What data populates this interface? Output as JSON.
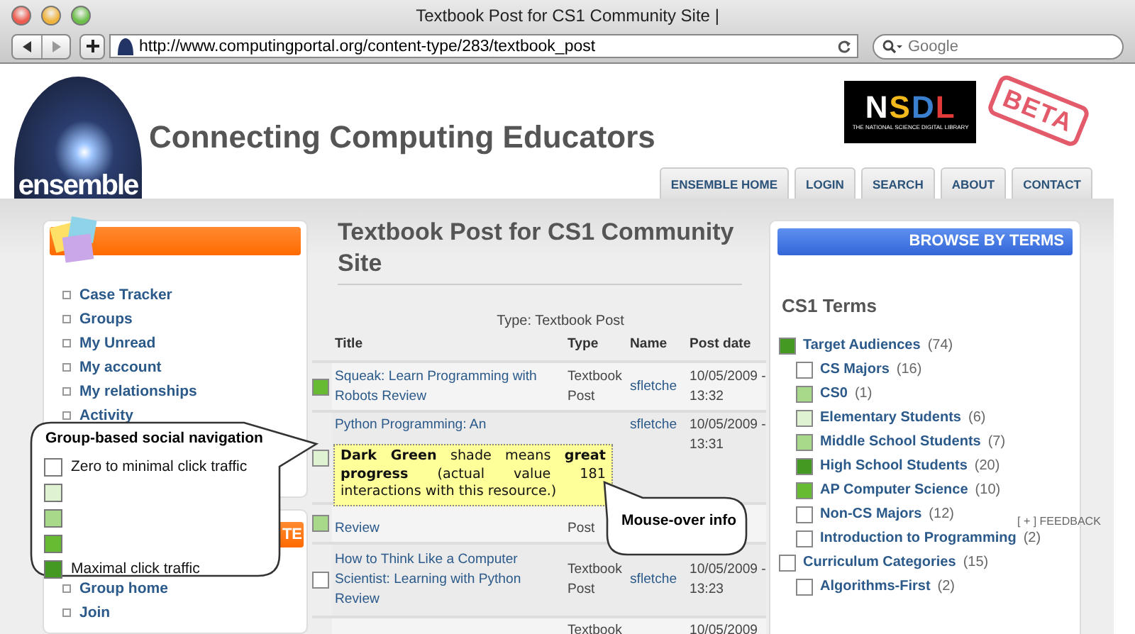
{
  "window": {
    "title": "Textbook Post for CS1 Community Site |"
  },
  "toolbar": {
    "url": "http://www.computingportal.org/content-type/283/textbook_post",
    "search": {
      "placeholder": "Google"
    }
  },
  "header": {
    "logo_text": "ensemble",
    "site_title": "Connecting Computing Educators",
    "partner_logo": {
      "name": "NSDL",
      "tagline": "THE NATIONAL SCIENCE DIGITAL LIBRARY"
    },
    "stamp": "BETA",
    "tabs": [
      {
        "label": "ENSEMBLE HOME",
        "selected": false
      },
      {
        "label": "LOGIN",
        "selected": false
      },
      {
        "label": "SEARCH",
        "selected": false
      },
      {
        "label": "ABOUT",
        "selected": false
      },
      {
        "label": "CONTACT",
        "selected": false
      }
    ]
  },
  "sidebar": {
    "items": [
      "Case Tracker",
      "Groups",
      "My Unread",
      "My account",
      "My relationships",
      "Activity"
    ],
    "group_box": {
      "heading": "TE",
      "items": [
        "Group home",
        "Join"
      ]
    }
  },
  "main": {
    "title": "Textbook Post for CS1 Community Site",
    "table": {
      "caption": "Type: Textbook Post",
      "columns": [
        "Title",
        "Type",
        "Name",
        "Post date"
      ],
      "rows": [
        {
          "color": "#66bb33",
          "title": "Squeak: Learn Programming with Robots Review",
          "type": "Textbook Post",
          "name": "sfletche",
          "date": "10/05/2009 - 13:32"
        },
        {
          "color": "#dff2d2",
          "title": "Python Programming:  An",
          "name": "sfletche",
          "date": "10/05/2009 - 13:31"
        },
        {
          "color": "#a8d88a",
          "title": "Review",
          "type": "Post"
        },
        {
          "color": "#ffffff",
          "title": "How to Think Like a Computer Scientist: Learning with Python Review",
          "type": "Textbook Post",
          "name": "sfletche",
          "date": "10/05/2009 - 13:23"
        },
        {
          "type": "Textbook",
          "date": "10/05/2009"
        }
      ]
    }
  },
  "terms": {
    "heading": "BROWSE BY TERMS",
    "subtitle": "CS1 Terms",
    "tree": [
      {
        "label": "Target Audiences",
        "count": "(74)",
        "color": "#449922",
        "children": [
          {
            "label": "CS Majors",
            "count": "(16)",
            "color": "#ffffff"
          },
          {
            "label": "CS0",
            "count": "(1)",
            "color": "#a8d88a"
          },
          {
            "label": "Elementary Students",
            "count": "(6)",
            "color": "#dff2d2"
          },
          {
            "label": "Middle School Students",
            "count": "(7)",
            "color": "#a8d88a"
          },
          {
            "label": "High School Students",
            "count": "(20)",
            "color": "#449922"
          },
          {
            "label": "AP Computer Science",
            "count": "(10)",
            "color": "#66bb33"
          },
          {
            "label": "Non-CS Majors",
            "count": "(12)",
            "color": "#ffffff"
          },
          {
            "label": "Introduction to Programming",
            "count": "(2)",
            "color": "#ffffff"
          }
        ]
      },
      {
        "label": "Curriculum Categories",
        "count": "(15)",
        "color": "#ffffff",
        "children": [
          {
            "label": "Algorithms-First",
            "count": "(2)",
            "color": "#ffffff"
          }
        ]
      }
    ],
    "feedback": "[ + ] FEEDBACK"
  },
  "legend": {
    "title": "Group-based social navigation",
    "levels": [
      {
        "color": "#ffffff",
        "label": "Zero to minimal click traffic"
      },
      {
        "color": "#dff2d2"
      },
      {
        "color": "#a8d88a"
      },
      {
        "color": "#66bb33"
      },
      {
        "color": "#449922",
        "label": "Maximal click traffic"
      }
    ]
  },
  "tooltip": {
    "text": "**Dark Green** shade means **great progress** (actual value 181 interactions with this resource.)"
  },
  "mouseover_callout": {
    "label": "Mouse-over info"
  }
}
